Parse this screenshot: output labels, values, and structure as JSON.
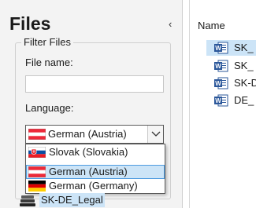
{
  "left": {
    "title": "Files",
    "filter": {
      "legend": "Filter Files",
      "file_name_label": "File name:",
      "file_name_value": "",
      "language_label": "Language:",
      "selected_language": "German (Austria)"
    },
    "dropdown_options": [
      {
        "label": "Slovak (Slovakia)",
        "flag": "flag-slovakia-icon",
        "state": "normal"
      },
      {
        "label": "German (Austria)",
        "flag": "flag-austria-icon",
        "state": "highlighted"
      },
      {
        "label": "German (Germany)",
        "flag": "flag-germany-icon",
        "state": "normal"
      }
    ],
    "bottom_item": {
      "label": "SK-DE_Legal",
      "icon": "termbase-icon"
    }
  },
  "right": {
    "column_header": "Name",
    "files": [
      {
        "name": "SK_",
        "icon": "word-document-icon",
        "selected": true
      },
      {
        "name": "SK_",
        "icon": "word-document-icon",
        "selected": false
      },
      {
        "name": "SK-D",
        "icon": "word-document-icon",
        "selected": false
      },
      {
        "name": "DE_",
        "icon": "word-document-icon",
        "selected": false
      }
    ]
  },
  "colors": {
    "selection": "#cce4f7",
    "highlight_border": "#4d9be0",
    "word_blue": "#2b579a",
    "panel_bg": "#f3f3f3"
  }
}
